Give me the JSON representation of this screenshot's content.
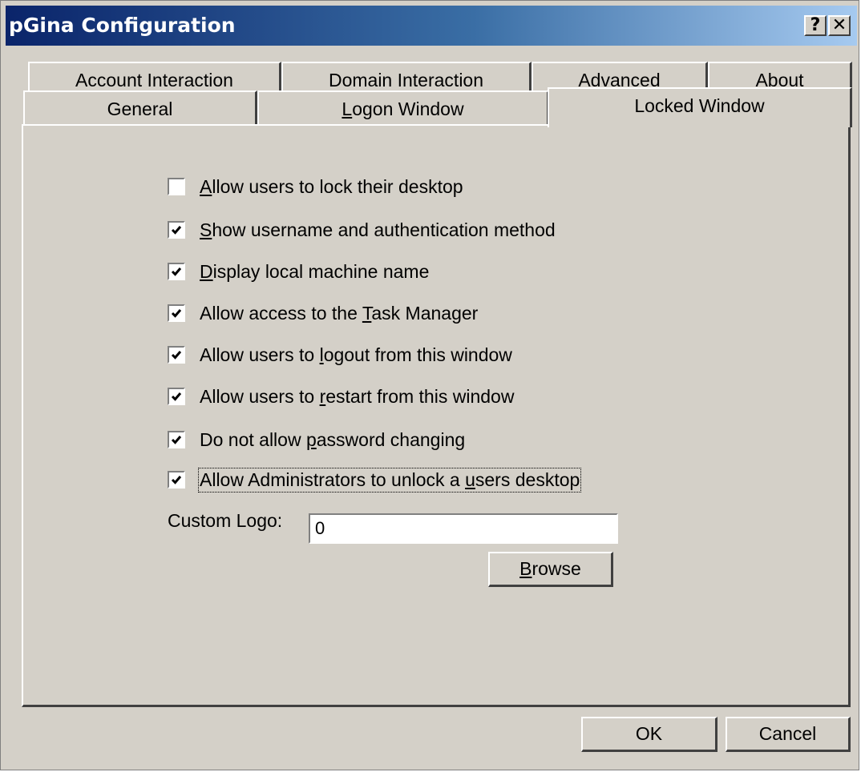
{
  "window": {
    "title": "pGina Configuration",
    "help_glyph": "?",
    "close_glyph": "✕"
  },
  "tabs": {
    "top_row": [
      "Account Interaction",
      "Domain Interaction",
      "Advanced",
      "About"
    ],
    "bottom_row": [
      "General",
      "Logon Window",
      "Locked Window"
    ],
    "active": "Locked Window"
  },
  "options": [
    {
      "pre": "",
      "key": "A",
      "post": "llow users to lock their desktop",
      "checked": false
    },
    {
      "pre": "",
      "key": "S",
      "post": "how username and authentication method",
      "checked": true
    },
    {
      "pre": "",
      "key": "D",
      "post": "isplay local machine name",
      "checked": true
    },
    {
      "pre": "Allow access to the ",
      "key": "T",
      "post": "ask Manager",
      "checked": true
    },
    {
      "pre": "Allow users to ",
      "key": "l",
      "post": "ogout from this window",
      "checked": true
    },
    {
      "pre": "Allow users to ",
      "key": "r",
      "post": "estart from this window",
      "checked": true
    },
    {
      "pre": "Do not allow ",
      "key": "p",
      "post": "assword changing",
      "checked": true
    },
    {
      "pre": "Allow Administrators to unlock a ",
      "key": "u",
      "post": "sers desktop",
      "checked": true
    }
  ],
  "custom_logo": {
    "label": "Custom Logo:",
    "value": "0"
  },
  "browse_button": {
    "key": "B",
    "rest": "rowse"
  },
  "footer": {
    "ok_label": "OK",
    "cancel_label": "Cancel"
  }
}
